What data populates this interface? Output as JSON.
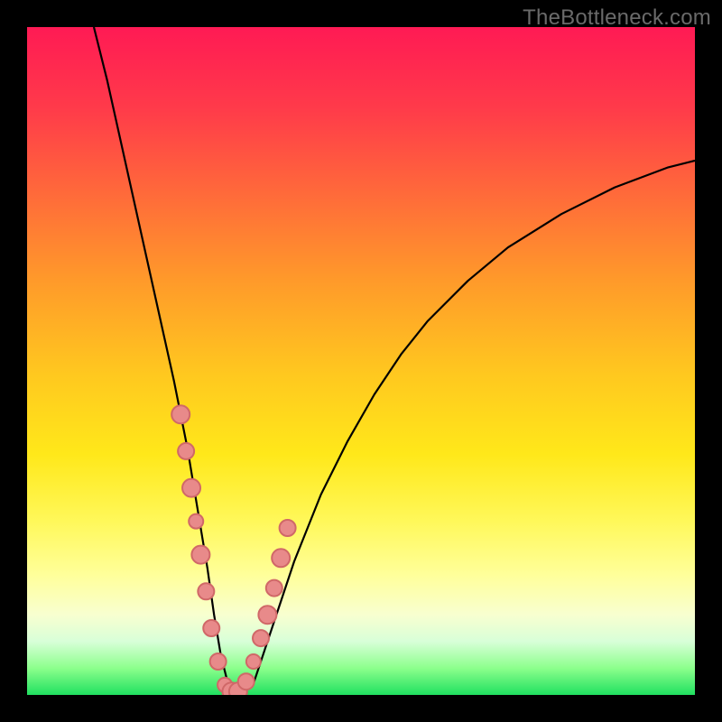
{
  "watermark": "TheBottleneck.com",
  "accent_point_color": "#e88a8a",
  "curve_color": "#000000",
  "chart_data": {
    "type": "line",
    "title": "",
    "xlabel": "",
    "ylabel": "",
    "xlim": [
      0,
      100
    ],
    "ylim": [
      0,
      100
    ],
    "grid": false,
    "legend": false,
    "series": [
      {
        "name": "bottleneck-curve",
        "x": [
          10,
          12,
          14,
          16,
          18,
          20,
          22,
          24,
          26,
          27,
          28,
          29,
          30,
          31,
          32,
          34,
          36,
          38,
          40,
          44,
          48,
          52,
          56,
          60,
          66,
          72,
          80,
          88,
          96,
          100
        ],
        "y": [
          100,
          92,
          83,
          74,
          65,
          56,
          47,
          37,
          25,
          19,
          12,
          6,
          2,
          0,
          0,
          2,
          8,
          14,
          20,
          30,
          38,
          45,
          51,
          56,
          62,
          67,
          72,
          76,
          79,
          80
        ]
      }
    ],
    "highlight_points": {
      "name": "segment-markers",
      "x": [
        23.0,
        23.8,
        24.6,
        25.3,
        26.0,
        26.8,
        27.6,
        28.6,
        29.6,
        30.6,
        31.6,
        32.8,
        33.9,
        35.0,
        36.0,
        37.0,
        38.0,
        39.0
      ],
      "y": [
        42.0,
        36.5,
        31.0,
        26.0,
        21.0,
        15.5,
        10.0,
        5.0,
        1.5,
        0.5,
        0.5,
        2.0,
        5.0,
        8.5,
        12.0,
        16.0,
        20.5,
        25.0
      ],
      "r": [
        10,
        9,
        10,
        8,
        10,
        9,
        9,
        9,
        8,
        10,
        10,
        9,
        8,
        9,
        10,
        9,
        10,
        9
      ]
    }
  }
}
